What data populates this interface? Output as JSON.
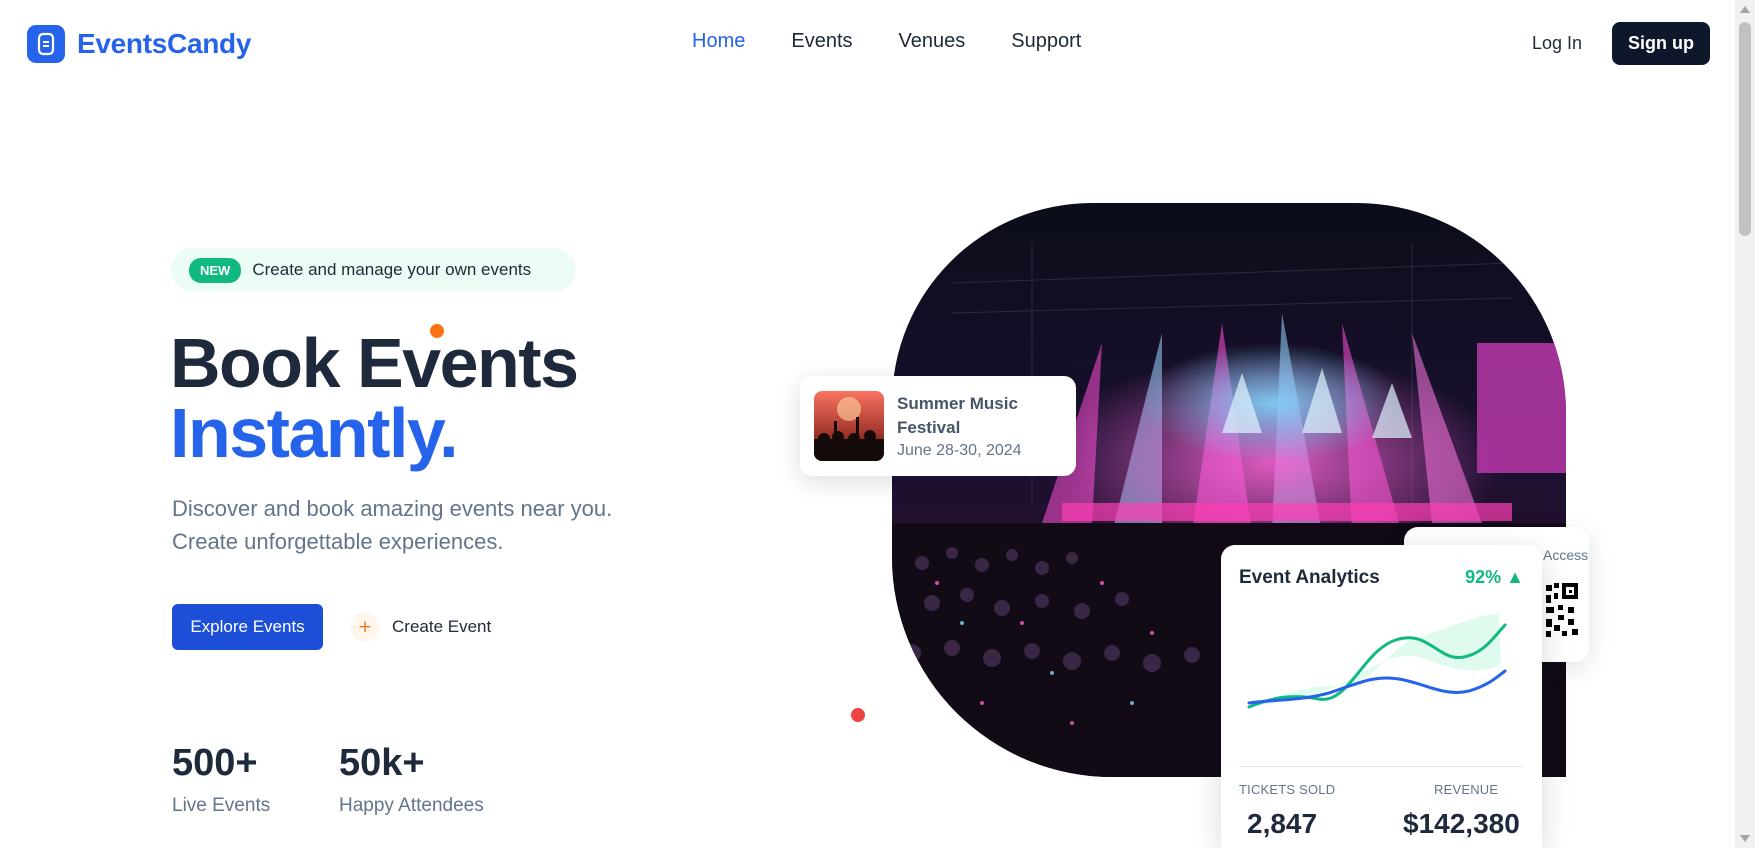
{
  "brand": {
    "name": "EventsCandy",
    "accent": "#2563eb"
  },
  "nav": {
    "items": [
      {
        "label": "Home",
        "active": true
      },
      {
        "label": "Events",
        "active": false
      },
      {
        "label": "Venues",
        "active": false
      },
      {
        "label": "Support",
        "active": false
      }
    ],
    "login_label": "Log In",
    "signup_label": "Sign up"
  },
  "hero": {
    "badge_pill": "NEW",
    "badge_text": "Create and manage your own events",
    "headline_line1": "Book Events",
    "headline_line2": "Instantly.",
    "subtitle_line1": "Discover and book amazing events near you.",
    "subtitle_line2": "Create unforgettable experiences.",
    "primary_cta": "Explore Events",
    "secondary_cta": "Create Event",
    "stats": [
      {
        "value": "500+",
        "label": "Live Events"
      },
      {
        "value": "50k+",
        "label": "Happy Attendees"
      }
    ]
  },
  "event_card": {
    "title": "Summer Music Festival",
    "date": "June 28-30, 2024"
  },
  "access_card": {
    "label": "Access"
  },
  "analytics": {
    "title": "Event Analytics",
    "change": "92% ▲",
    "tickets_label": "TICKETS SOLD",
    "tickets_value": "2,847",
    "revenue_label": "REVENUE",
    "revenue_value": "$142,380",
    "colors": {
      "line_a": "#10b981",
      "line_b": "#2563eb"
    }
  }
}
